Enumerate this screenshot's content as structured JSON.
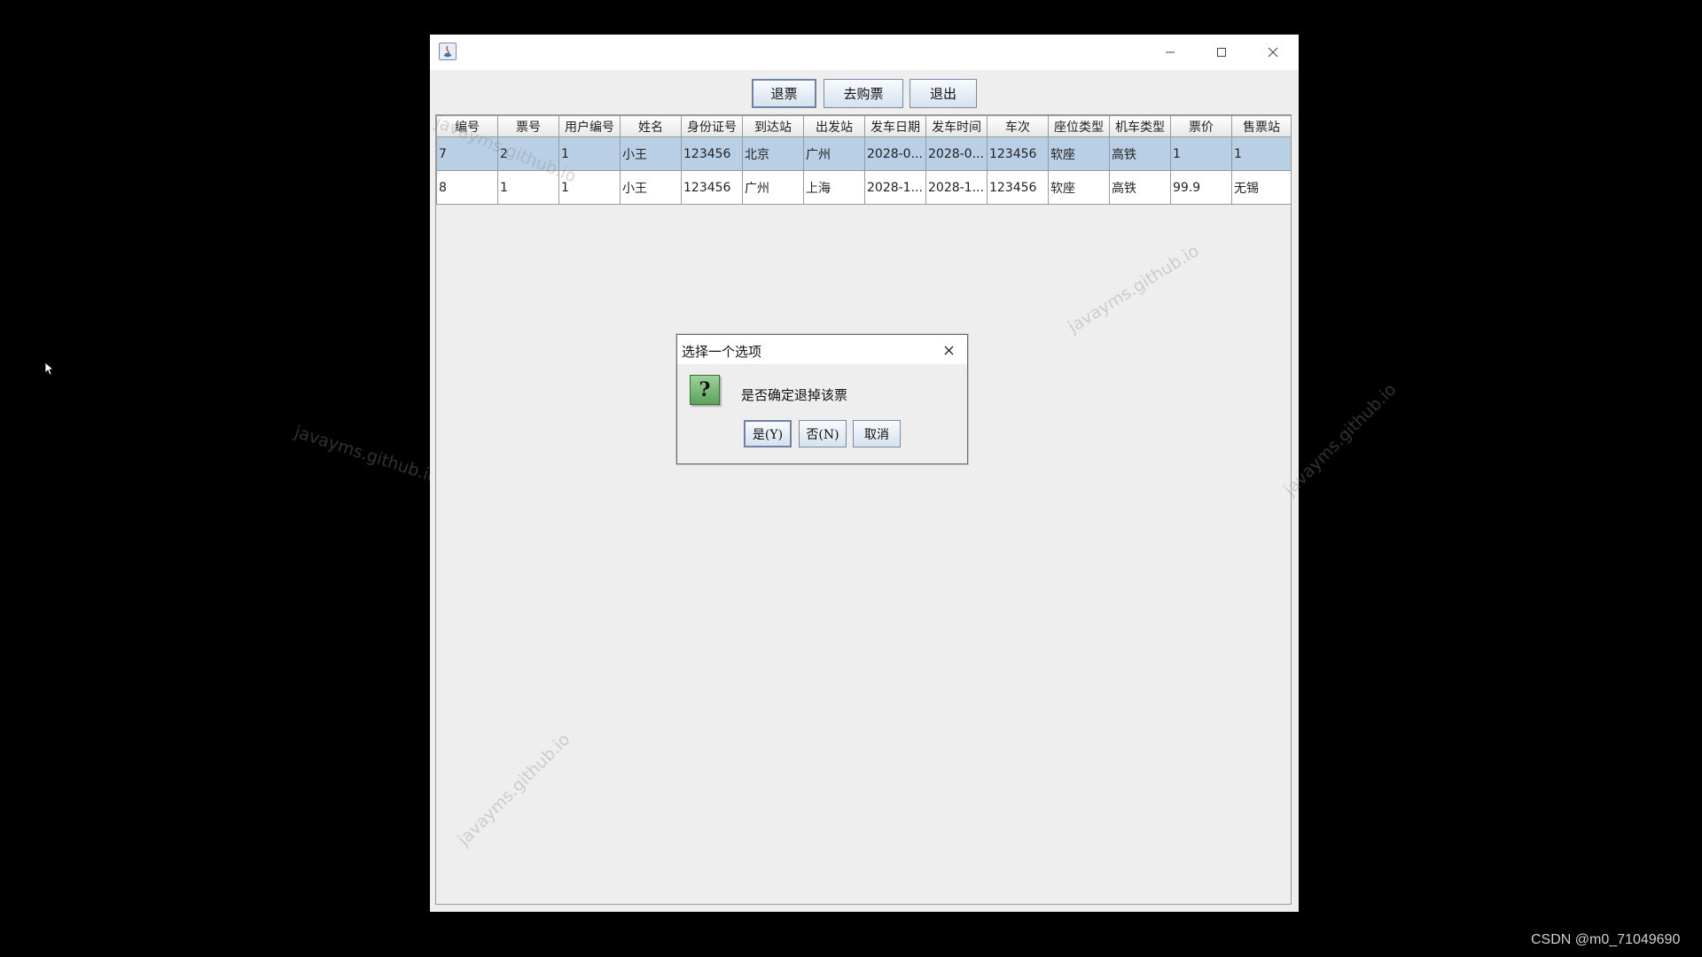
{
  "toolbar": {
    "refund_label": "退票",
    "buy_label": "去购票",
    "exit_label": "退出"
  },
  "table": {
    "columns": [
      "编号",
      "票号",
      "用户编号",
      "姓名",
      "身份证号",
      "到达站",
      "出发站",
      "发车日期",
      "发车时间",
      "车次",
      "座位类型",
      "机车类型",
      "票价",
      "售票站"
    ],
    "rows": [
      [
        "7",
        "2",
        "1",
        "小王",
        "123456",
        "北京",
        "广州",
        "2028-0...",
        "2028-0...",
        "123456",
        "软座",
        "高铁",
        "1",
        "1"
      ],
      [
        "8",
        "1",
        "1",
        "小王",
        "123456",
        "广州",
        "上海",
        "2028-1...",
        "2028-1...",
        "123456",
        "软座",
        "高铁",
        "99.9",
        "无锡"
      ]
    ],
    "selected_row": 0
  },
  "dialog": {
    "title": "选择一个选项",
    "message": "是否确定退掉该票",
    "yes_label": "是(Y)",
    "no_label": "否(N)",
    "cancel_label": "取消"
  },
  "watermark": "javayms.github.io",
  "credit": "CSDN @m0_71049690",
  "icons": {
    "window": "java-icon",
    "minimize": "minimize-icon",
    "maximize": "maximize-icon",
    "close": "close-icon",
    "dialog": "question-icon",
    "cursor": "mouse-cursor-icon"
  },
  "colors": {
    "selected_row": "#b8cfe5",
    "window_bg": "#eeeeee",
    "question_icon": "#5aa35a"
  }
}
